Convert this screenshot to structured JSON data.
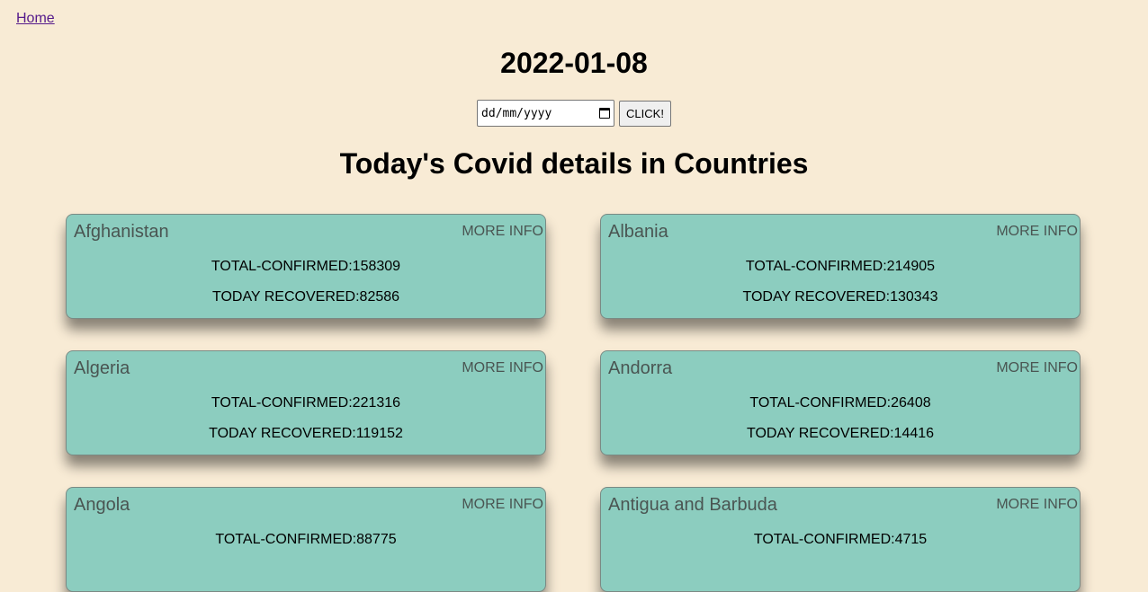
{
  "nav": {
    "home_label": "Home"
  },
  "header": {
    "date_title": "2022-01-08"
  },
  "date_picker": {
    "placeholder": "dd/mm/yyyy",
    "button_label": "CLICK!"
  },
  "section": {
    "title": "Today's Covid details in Countries"
  },
  "cards": [
    {
      "country": "Afghanistan",
      "more_label": "MORE INFO",
      "confirmed_text": "TOTAL-CONFIRMED:158309",
      "recovered_text": "TODAY RECOVERED:82586"
    },
    {
      "country": "Albania",
      "more_label": "MORE INFO",
      "confirmed_text": "TOTAL-CONFIRMED:214905",
      "recovered_text": "TODAY RECOVERED:130343"
    },
    {
      "country": "Algeria",
      "more_label": "MORE INFO",
      "confirmed_text": "TOTAL-CONFIRMED:221316",
      "recovered_text": "TODAY RECOVERED:119152"
    },
    {
      "country": "Andorra",
      "more_label": "MORE INFO",
      "confirmed_text": "TOTAL-CONFIRMED:26408",
      "recovered_text": "TODAY RECOVERED:14416"
    },
    {
      "country": "Angola",
      "more_label": "MORE INFO",
      "confirmed_text": "TOTAL-CONFIRMED:88775",
      "recovered_text": ""
    },
    {
      "country": "Antigua and Barbuda",
      "more_label": "MORE INFO",
      "confirmed_text": "TOTAL-CONFIRMED:4715",
      "recovered_text": ""
    }
  ],
  "colors": {
    "page_background": "#f8ebd5",
    "card_background": "#8ccdbf",
    "link": "#551a8b"
  }
}
